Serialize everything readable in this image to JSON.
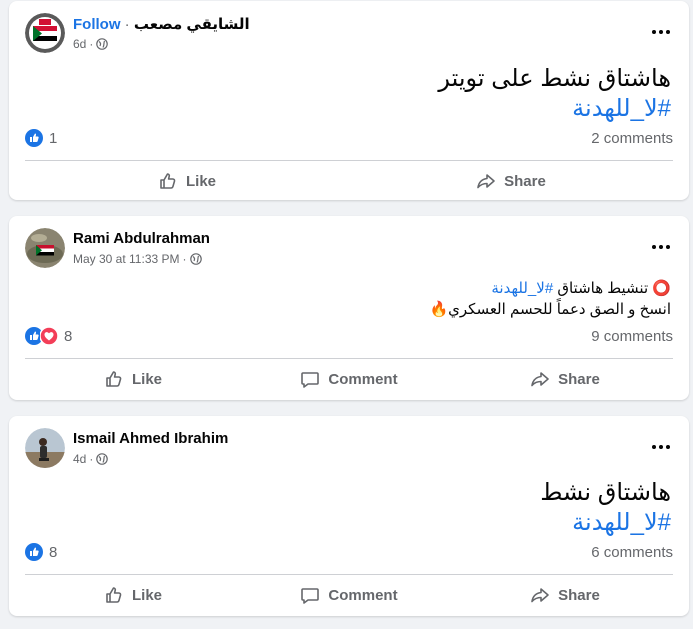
{
  "posts": [
    {
      "author": "الشايقي مصعب",
      "follow_label": "Follow",
      "separator": "·",
      "time": "6d",
      "line1": "هاشتاق نشط على تويتر",
      "hashtag": "#لا_للهدنة",
      "reaction_count": "1",
      "comments": "2 comments",
      "actions": {
        "like": "Like",
        "share": "Share"
      }
    },
    {
      "author": "Rami Abdulrahman",
      "time": "May 30 at 11:33 PM",
      "separator": "·",
      "line1_icon": "⭕",
      "line1_text": "تنشيط هاشتاق",
      "hashtag": "#لا_للهدنة",
      "line2": "انسخ و الصق دعماً للحسم العسكري",
      "line2_emoji": "🔥",
      "reaction_count": "8",
      "comments": "9 comments",
      "actions": {
        "like": "Like",
        "comment": "Comment",
        "share": "Share"
      }
    },
    {
      "author": "Ismail Ahmed Ibrahim",
      "time": "4d",
      "separator": "·",
      "line1": "هاشتاق نشط",
      "hashtag": "#لا_للهدنة",
      "reaction_count": "8",
      "comments": "6 comments",
      "actions": {
        "like": "Like",
        "comment": "Comment",
        "share": "Share"
      }
    }
  ],
  "icons": {
    "like": "thumbs-up-icon",
    "love": "heart-icon",
    "comment": "comment-bubble-icon",
    "share": "share-arrow-icon",
    "globe": "globe-icon",
    "more": "more-horizontal-icon"
  },
  "colors": {
    "accent": "#1b74e4",
    "secondary_text": "#65676b",
    "love": "#f33e58",
    "background": "#f0f2f5"
  }
}
